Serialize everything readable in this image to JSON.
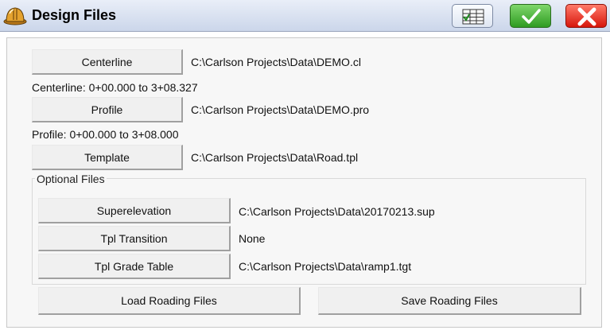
{
  "window": {
    "title": "Design Files",
    "icons": {
      "app": "hardhat-icon",
      "list": "list-icon",
      "ok": "checkmark-icon",
      "close": "close-x-icon"
    },
    "colors": {
      "ok": "#2f9c22",
      "close": "#d7160b"
    }
  },
  "files": {
    "centerline": {
      "label": "Centerline",
      "path": "C:\\Carlson Projects\\Data\\DEMO.cl",
      "info": "Centerline: 0+00.000 to 3+08.327"
    },
    "profile": {
      "label": "Profile",
      "path": "C:\\Carlson Projects\\Data\\DEMO.pro",
      "info": "Profile: 0+00.000 to 3+08.000"
    },
    "template": {
      "label": "Template",
      "path": "C:\\Carlson Projects\\Data\\Road.tpl"
    }
  },
  "optional": {
    "title": "Optional Files",
    "superelevation": {
      "label": "Superelevation",
      "path": "C:\\Carlson Projects\\Data\\20170213.sup"
    },
    "tpl_transition": {
      "label": "Tpl Transition",
      "path": "None"
    },
    "tpl_grade_table": {
      "label": "Tpl Grade Table",
      "path": "C:\\Carlson Projects\\Data\\ramp1.tgt"
    }
  },
  "actions": {
    "load": "Load Roading Files",
    "save": "Save Roading Files"
  }
}
